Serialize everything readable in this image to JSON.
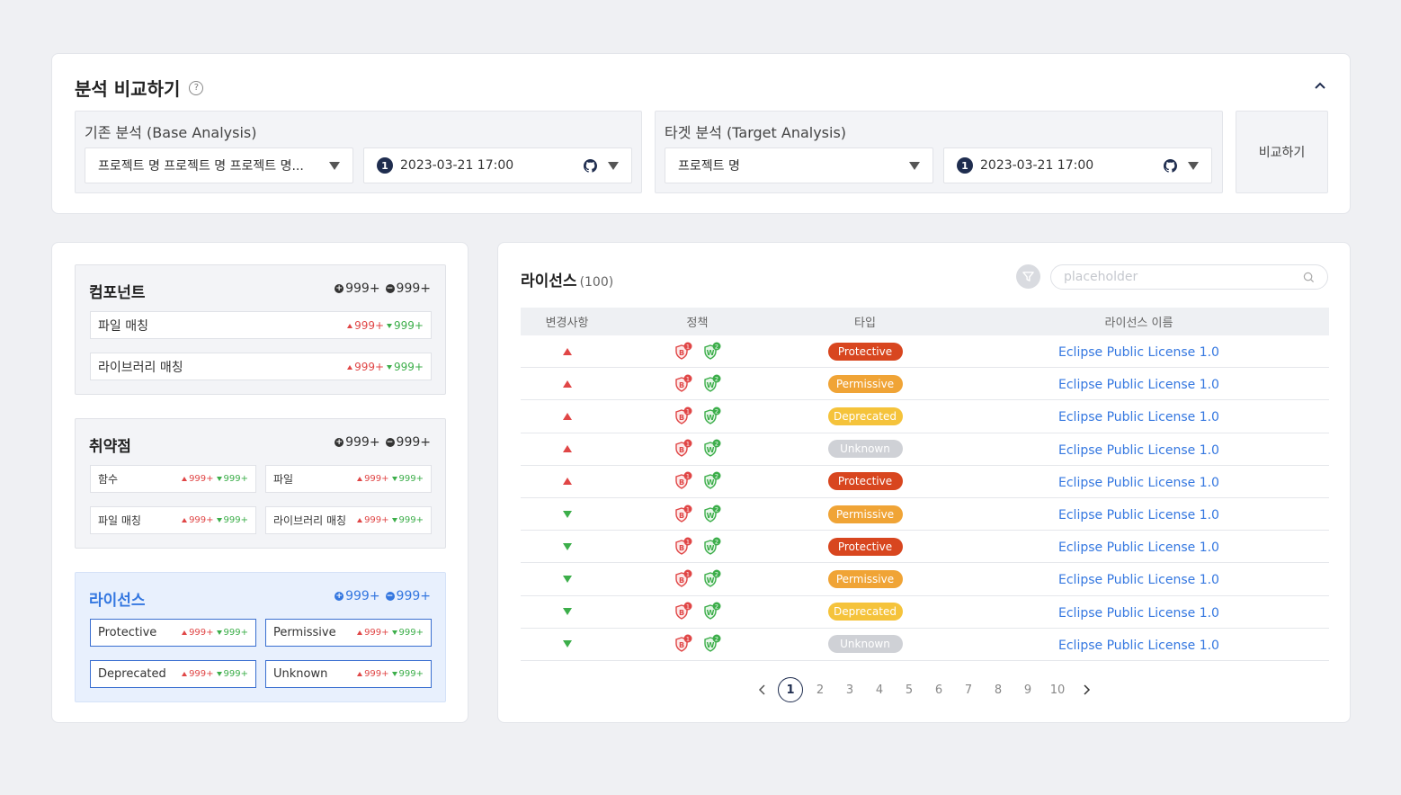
{
  "compare": {
    "title": "분석 비교하기",
    "help_icon": "?",
    "base": {
      "title": "기존 분석 (Base Analysis)",
      "project": "프로젝트 명 프로젝트 명 프로젝트 명...",
      "version_num": "1",
      "datetime": "2023-03-21 17:00"
    },
    "target": {
      "title": "타겟 분석 (Target Analysis)",
      "project": "프로젝트 명",
      "version_num": "1",
      "datetime": "2023-03-21 17:00"
    },
    "compare_button": "비교하기"
  },
  "summary": {
    "component": {
      "title": "컴포넌트",
      "plus": "999+",
      "minus": "999+",
      "items": [
        {
          "label": "파일 매칭",
          "up": "999+",
          "down": "999+"
        },
        {
          "label": "라이브러리 매칭",
          "up": "999+",
          "down": "999+"
        }
      ]
    },
    "vulnerability": {
      "title": "취약점",
      "plus": "999+",
      "minus": "999+",
      "items": [
        {
          "label": "함수",
          "up": "999+",
          "down": "999+"
        },
        {
          "label": "파일",
          "up": "999+",
          "down": "999+"
        },
        {
          "label": "파일 매칭",
          "up": "999+",
          "down": "999+"
        },
        {
          "label": "라이브러리 매칭",
          "up": "999+",
          "down": "999+"
        }
      ]
    },
    "license": {
      "title": "라이선스",
      "plus": "999+",
      "minus": "999+",
      "items": [
        {
          "label": "Protective",
          "up": "999+",
          "down": "999+"
        },
        {
          "label": "Permissive",
          "up": "999+",
          "down": "999+"
        },
        {
          "label": "Deprecated",
          "up": "999+",
          "down": "999+"
        },
        {
          "label": "Unknown",
          "up": "999+",
          "down": "999+"
        }
      ]
    }
  },
  "licenses": {
    "title": "라이선스",
    "count": "(100)",
    "search_placeholder": "placeholder",
    "columns": [
      "변경사항",
      "정책",
      "타입",
      "라이선스 이름"
    ],
    "policy_badges": {
      "b_label": "B",
      "b_count": "1",
      "w_label": "W",
      "w_count": "2"
    },
    "type_colors": {
      "Protective": "#d8461f",
      "Permissive": "#f0a436",
      "Deprecated": "#f5c33b",
      "Unknown": "#cfd1d6"
    },
    "rows": [
      {
        "change": "up",
        "type": "Protective",
        "name": "Eclipse Public License 1.0"
      },
      {
        "change": "up",
        "type": "Permissive",
        "name": "Eclipse Public License 1.0"
      },
      {
        "change": "up",
        "type": "Deprecated",
        "name": "Eclipse Public License 1.0"
      },
      {
        "change": "up",
        "type": "Unknown",
        "name": "Eclipse Public License 1.0"
      },
      {
        "change": "up",
        "type": "Protective",
        "name": "Eclipse Public License 1.0"
      },
      {
        "change": "down",
        "type": "Permissive",
        "name": "Eclipse Public License 1.0"
      },
      {
        "change": "down",
        "type": "Protective",
        "name": "Eclipse Public License 1.0"
      },
      {
        "change": "down",
        "type": "Permissive",
        "name": "Eclipse Public License 1.0"
      },
      {
        "change": "down",
        "type": "Deprecated",
        "name": "Eclipse Public License 1.0"
      },
      {
        "change": "down",
        "type": "Unknown",
        "name": "Eclipse Public License 1.0"
      }
    ],
    "pagination": {
      "current": "1",
      "pages": [
        "1",
        "2",
        "3",
        "4",
        "5",
        "6",
        "7",
        "8",
        "9",
        "10"
      ]
    }
  }
}
